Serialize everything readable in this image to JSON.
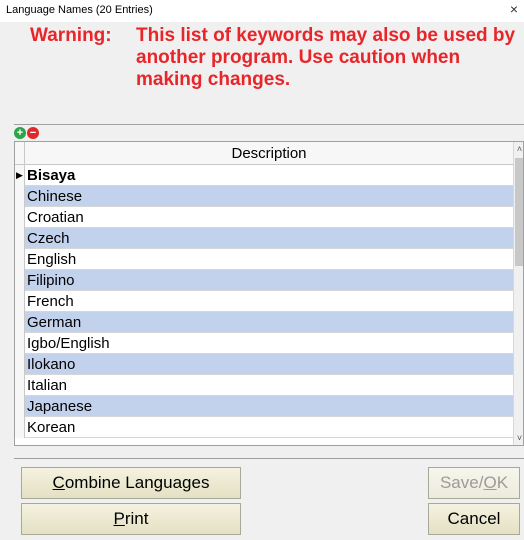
{
  "window": {
    "title": "Language Names (20 Entries)",
    "close_glyph": "×"
  },
  "warning": {
    "label": "Warning:",
    "text": "This list of keywords may also be used by another program. Use caution when making changes."
  },
  "toolbar": {
    "add_glyph": "+",
    "remove_glyph": "−"
  },
  "grid": {
    "header": "Description",
    "current_row_indicator": "▶",
    "rows": [
      "Bisaya",
      "Chinese",
      "Croatian",
      "Czech",
      "English",
      "Filipino",
      "French",
      "German",
      "Igbo/English",
      "Ilokano",
      "Italian",
      "Japanese",
      "Korean"
    ]
  },
  "scroll": {
    "up_glyph": "˄",
    "down_glyph": "˅"
  },
  "buttons": {
    "combine_languages": {
      "mnemonic": "C",
      "rest": "ombine Languages"
    },
    "print": {
      "mnemonic": "P",
      "rest": "rint"
    },
    "save_ok": {
      "pre": "Save/",
      "mnemonic": "O",
      "rest": "K"
    },
    "cancel": "Cancel"
  },
  "colors": {
    "warning": "#e8262a",
    "row_alt": "#c3d2ec",
    "add": "#2fa34a",
    "remove": "#e02a2a"
  }
}
